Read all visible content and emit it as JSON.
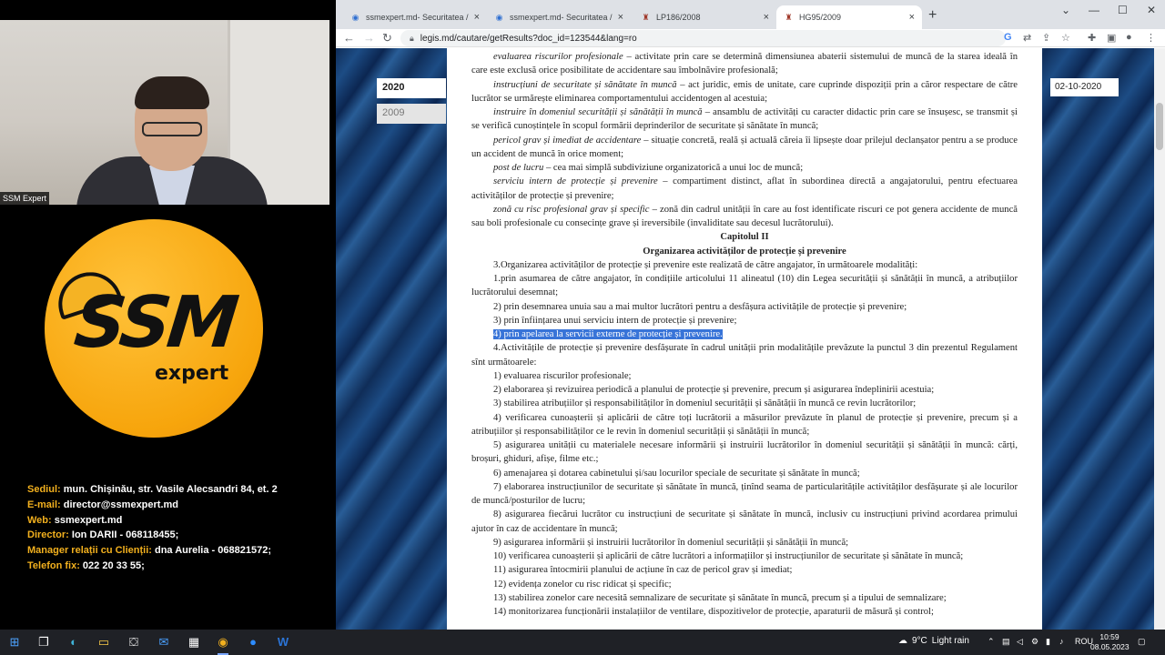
{
  "webcam": {
    "label": "SSM Expert"
  },
  "logo": {
    "word": "SSM",
    "sub": "expert"
  },
  "contact": [
    {
      "k": "Sediul:",
      "v": "mun. Chișinău, str. Vasile Alecsandri 84, et. 2"
    },
    {
      "k": "E-mail:",
      "v": "director@ssmexpert.md"
    },
    {
      "k": "Web:",
      "v": "ssmexpert.md"
    },
    {
      "k": "Director:",
      "v": "Ion DARII - 068118455;"
    },
    {
      "k": "Manager relații cu Clienții:",
      "v": "dna Aurelia - 068821572;"
    },
    {
      "k": "Telefon fix:",
      "v": "022 20 33 55;"
    }
  ],
  "tabs": [
    {
      "label": "ssmexpert.md- Securitatea / Prot"
    },
    {
      "label": "ssmexpert.md- Securitatea / Prot"
    },
    {
      "label": "LP186/2008"
    },
    {
      "label": "HG95/2009"
    }
  ],
  "url": "legis.md/cautare/getResults?doc_id=123544&lang=ro",
  "years": [
    "2020",
    "2009"
  ],
  "date": "02-10-2020",
  "doc": [
    {
      "t": "i",
      "a": "evaluarea riscurilor profesionale",
      "b": " – activitate prin care se determină dimensiunea abaterii sistemului de muncă de la starea ideală în care este exclusă orice posibilitate de accidentare sau îmbolnăvire profesională;"
    },
    {
      "t": "i",
      "a": "instrucțiuni de securitate și sănătate în muncă",
      "b": " – act juridic, emis de unitate, care cuprinde dispoziții prin a căror respectare de către lucrător se urmărește eliminarea comportamentului accidentogen al acestuia;"
    },
    {
      "t": "i",
      "a": "instruire în domeniul securității și sănătății în muncă",
      "b": " – ansamblu de activități cu caracter didactic prin care se însușesc, se transmit și se verifică cunoștințele în scopul formării deprinderilor de securitate și sănătate în muncă;"
    },
    {
      "t": "i",
      "a": "pericol grav și imediat de accidentare",
      "b": " – situație concretă, reală și actuală căreia îi lipsește doar prilejul declanșator pentru a se produce un accident de muncă în orice moment;"
    },
    {
      "t": "i",
      "a": "post de lucru",
      "b": " – cea mai simplă subdiviziune organizatorică a unui loc de muncă;"
    },
    {
      "t": "i",
      "a": "serviciu intern de protecție și prevenire",
      "b": " – compartiment distinct, aflat în subordinea directă a angajatorului, pentru efectuarea activităților de protecție și prevenire;"
    },
    {
      "t": "i",
      "a": "zonă cu risc profesional grav și specific",
      "b": " – zonă din cadrul unității în care au fost identificate riscuri ce pot genera accidente de muncă sau boli profesionale cu consecințe grave și ireversibile (invaliditate sau decesul lucrătorului)."
    },
    {
      "t": "c",
      "b": "Capitolul II"
    },
    {
      "t": "c",
      "b": "Organizarea activităților de protecție și prevenire"
    },
    {
      "t": "p",
      "b": "3.Organizarea activităților de protecție și prevenire este realizată de către angajator, în următoarele modalități:"
    },
    {
      "t": "p",
      "b": "1.prin asumarea de către angajator, în condițiile articolului 11 alineatul (10) din Legea securității și sănătății în muncă, a atribuțiilor lucrătorului desemnat;"
    },
    {
      "t": "p",
      "b": "2) prin desemnarea unuia sau a mai multor lucrători pentru a desfășura activitățile de protecție și prevenire;"
    },
    {
      "t": "p",
      "b": "3) prin înființarea unui serviciu intern de protecție și prevenire;"
    },
    {
      "t": "h",
      "b": "4) prin apelarea la servicii externe de protecție și prevenire."
    },
    {
      "t": "p",
      "b": "4.Activitățile de protecție și prevenire desfășurate în cadrul unității prin modalitățile prevăzute la punctul 3 din prezentul Regulament sînt următoarele:"
    },
    {
      "t": "p",
      "b": "1) evaluarea riscurilor profesionale;"
    },
    {
      "t": "p",
      "b": "2) elaborarea și revizuirea periodică a planului de protecție și prevenire, precum și asigurarea îndeplinirii acestuia;"
    },
    {
      "t": "p",
      "b": "3) stabilirea atribuțiilor și responsabilităților în domeniul securității și sănătății în muncă ce revin lucrătorilor;"
    },
    {
      "t": "p",
      "b": "4) verificarea cunoașterii și aplicării de către toți lucrătorii a măsurilor prevăzute în planul de protecție și prevenire, precum și a atribuțiilor și responsabilităților ce le revin în domeniul securității și sănătății în muncă;"
    },
    {
      "t": "p",
      "b": "5) asigurarea unității cu materialele necesare informării și instruirii lucrătorilor în domeniul securității și sănătății în muncă: cărți, broșuri, ghiduri, afișe, filme etc.;"
    },
    {
      "t": "p",
      "b": "6) amenajarea și dotarea cabinetului și/sau locurilor speciale de securitate și sănătate în muncă;"
    },
    {
      "t": "p",
      "b": "7) elaborarea instrucțiunilor de securitate și sănătate în muncă, ținînd seama de particularitățile activităților desfășurate și ale locurilor de muncă/posturilor de lucru;"
    },
    {
      "t": "p",
      "b": "8) asigurarea fiecărui lucrător cu instrucțiuni de securitate și sănătate în muncă, inclusiv cu instrucțiuni privind acordarea primului ajutor în caz de accidentare în muncă;"
    },
    {
      "t": "p",
      "b": "9) asigurarea informării și instruirii lucrătorilor în domeniul securității și sănătății în muncă;"
    },
    {
      "t": "p",
      "b": "10) verificarea cunoașterii și aplicării de către lucrători a informațiilor și instrucțiunilor de securitate și sănătate în muncă;"
    },
    {
      "t": "p",
      "b": "11) asigurarea întocmirii planului de acțiune în caz de pericol grav și imediat;"
    },
    {
      "t": "p",
      "b": "12) evidența zonelor cu risc ridicat și specific;"
    },
    {
      "t": "p",
      "b": "13) stabilirea zonelor care necesită semnalizare de securitate și sănătate în muncă, precum și a tipului de semnalizare;"
    },
    {
      "t": "p",
      "b": "14) monitorizarea funcționării instalațiilor de ventilare, dispozitivelor de protecție, aparaturii de măsură și control;"
    }
  ],
  "taskbar": {
    "weather_temp": "9°C",
    "weather_text": "Light rain",
    "lang": "ROU",
    "time": "10:59",
    "date": "08.05.2023"
  }
}
